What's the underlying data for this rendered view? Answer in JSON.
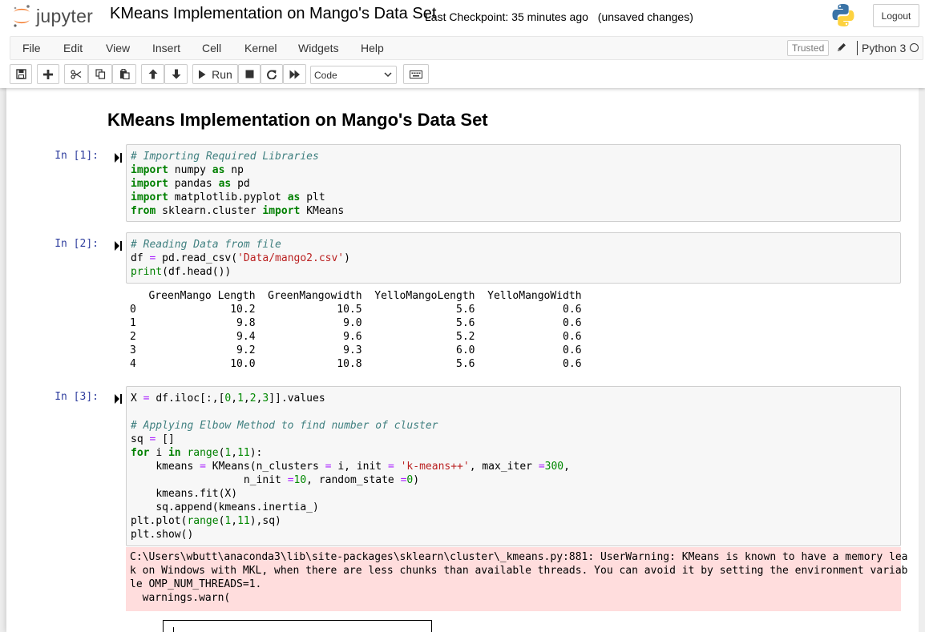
{
  "header": {
    "logo_text": "jupyter",
    "notebook_name": "KMeans Implementation on Mango's Data Set",
    "checkpoint": "Last Checkpoint: 35 minutes ago",
    "unsaved": "(unsaved changes)",
    "logout_label": "Logout"
  },
  "menubar": {
    "items": [
      "File",
      "Edit",
      "View",
      "Insert",
      "Cell",
      "Kernel",
      "Widgets",
      "Help"
    ],
    "trusted_label": "Trusted",
    "kernel_name": "Python 3"
  },
  "toolbar": {
    "run_label": "Run",
    "cell_type": "Code"
  },
  "notebook": {
    "heading": "KMeans Implementation on Mango's Data Set",
    "cells": [
      {
        "prompt": "In [1]:",
        "code_lines": [
          "# Importing Required Libraries",
          "import numpy as np",
          "import pandas as pd",
          "import matplotlib.pyplot as plt",
          "from sklearn.cluster import KMeans"
        ]
      },
      {
        "prompt": "In [2]:",
        "code_lines": [
          "# Reading Data from file",
          "df = pd.read_csv('Data/mango2.csv')",
          "print(df.head())"
        ],
        "output_lines": [
          "   GreenMango Length  GreenMangowidth  YelloMangoLength  YelloMangoWidth",
          "0               10.2             10.5               5.6              0.6",
          "1                9.8              9.0               5.6              0.6",
          "2                9.4              9.6               5.2              0.6",
          "3                9.2              9.3               6.0              0.6",
          "4               10.0             10.8               5.6              0.6"
        ]
      },
      {
        "prompt": "In [3]:",
        "code_lines": [
          "X = df.iloc[:,[0,1,2,3]].values",
          "",
          "# Applying Elbow Method to find number of cluster",
          "sq = []",
          "for i in range(1,11):",
          "    kmeans = KMeans(n_clusters = i, init = 'k-means++', max_iter =300,",
          "                  n_init =10, random_state =0)",
          "    kmeans.fit(X)",
          "    sq.append(kmeans.inertia_)",
          "plt.plot(range(1,11),sq)",
          "plt.show()"
        ],
        "stderr_lines": [
          "C:\\Users\\wbutt\\anaconda3\\lib\\site-packages\\sklearn\\cluster\\_kmeans.py:881: UserWarning: KMeans is known to have a memory lea",
          "k on Windows with MKL, when there are less chunks than available threads. You can avoid it by setting the environment variab",
          "le OMP_NUM_THREADS=1.",
          "  warnings.warn("
        ]
      }
    ]
  }
}
